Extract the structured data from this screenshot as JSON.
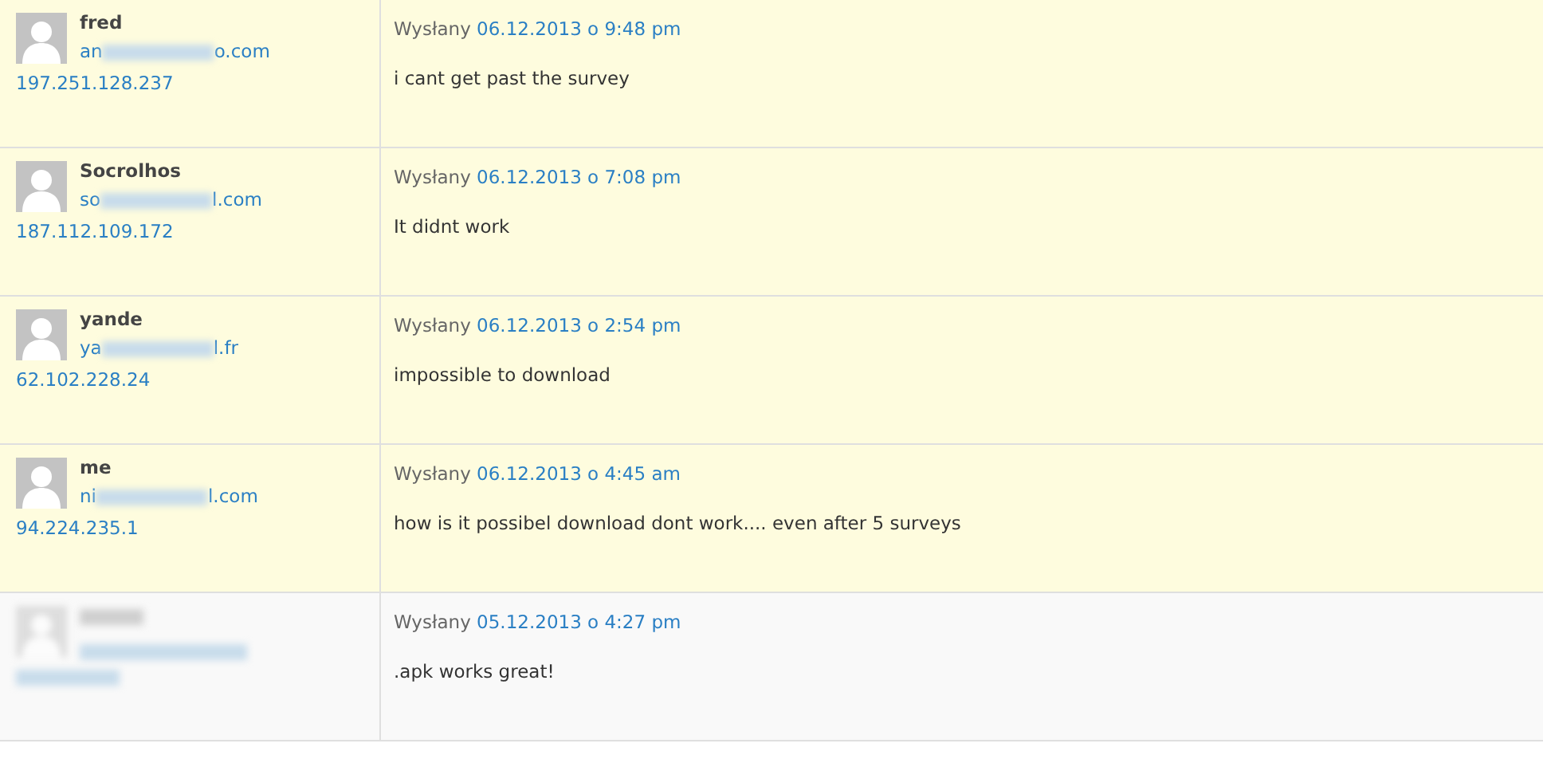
{
  "comments": [
    {
      "pending": true,
      "author_blurred": false,
      "author": "fred",
      "email": {
        "start": "an",
        "end": "o.com"
      },
      "ip": "197.251.128.237",
      "posted_label": "Wysłany",
      "date": "06.12.2013 o 9:48 pm",
      "text": "i cant get past the survey"
    },
    {
      "pending": true,
      "author_blurred": false,
      "author": "Socrolhos",
      "email": {
        "start": "so",
        "end": "l.com"
      },
      "ip": "187.112.109.172",
      "posted_label": "Wysłany",
      "date": "06.12.2013 o 7:08 pm",
      "text": "It didnt work"
    },
    {
      "pending": true,
      "author_blurred": false,
      "author": "yande",
      "email": {
        "start": "ya",
        "end": "l.fr"
      },
      "ip": "62.102.228.24",
      "posted_label": "Wysłany",
      "date": "06.12.2013 o 2:54 pm",
      "text": "impossible to download"
    },
    {
      "pending": true,
      "author_blurred": false,
      "author": "me",
      "email": {
        "start": "ni",
        "end": "l.com"
      },
      "ip": "94.224.235.1",
      "posted_label": "Wysłany",
      "date": "06.12.2013 o 4:45 am",
      "text": "how is it possibel download dont work.... even after 5 surveys"
    },
    {
      "pending": false,
      "author_blurred": true,
      "posted_label": "Wysłany",
      "date": "05.12.2013 o 4:27 pm",
      "text": ".apk works great!"
    }
  ]
}
